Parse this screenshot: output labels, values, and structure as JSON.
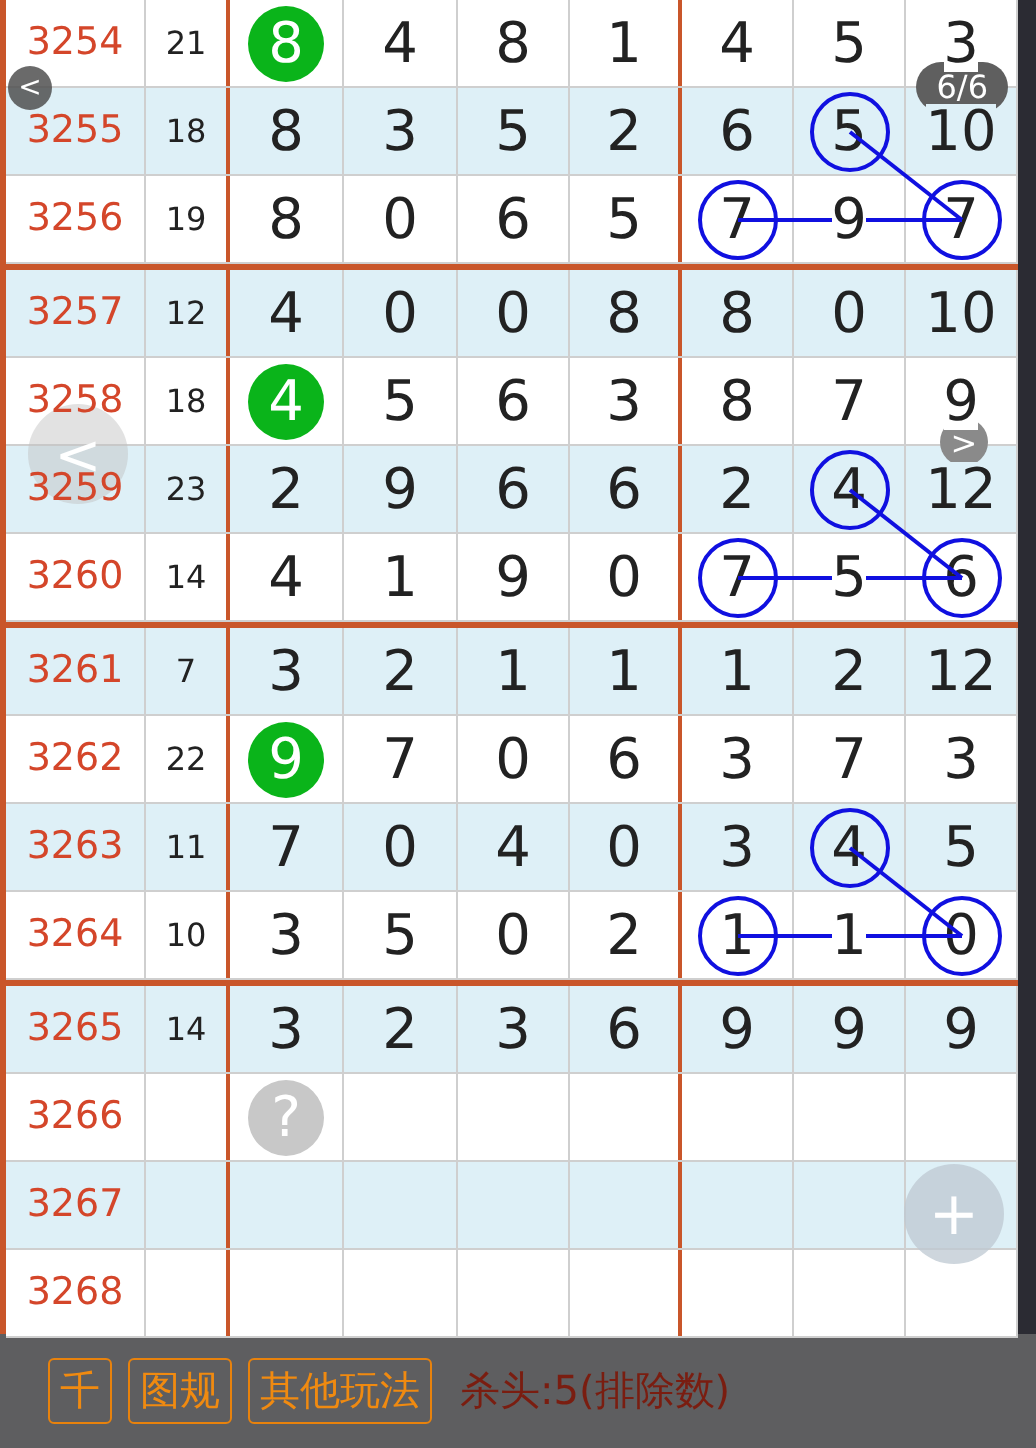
{
  "viewer": {
    "back": "<",
    "counter": "6/6",
    "prev": "<",
    "next": ">",
    "zoom": "+"
  },
  "groups": [
    {
      "rows": [
        {
          "issue": "3254",
          "sum": "21",
          "cells": [
            {
              "text": "8",
              "kind": "ball",
              "color": "#0ab41a"
            },
            {
              "text": "4",
              "kind": "plain"
            },
            {
              "text": "8",
              "kind": "plain"
            },
            {
              "text": "1",
              "kind": "plain"
            },
            {
              "text": "4",
              "kind": "plain"
            },
            {
              "text": "5",
              "kind": "plain"
            },
            {
              "text": "3",
              "kind": "plain"
            }
          ]
        },
        {
          "issue": "3255",
          "sum": "18",
          "cells": [
            {
              "text": "8",
              "kind": "plain"
            },
            {
              "text": "3",
              "kind": "plain"
            },
            {
              "text": "5",
              "kind": "plain"
            },
            {
              "text": "2",
              "kind": "plain"
            },
            {
              "text": "6",
              "kind": "plain"
            },
            {
              "text": "5",
              "kind": "ring"
            },
            {
              "text": "10",
              "kind": "plain"
            }
          ]
        },
        {
          "issue": "3256",
          "sum": "19",
          "cells": [
            {
              "text": "8",
              "kind": "plain"
            },
            {
              "text": "0",
              "kind": "plain"
            },
            {
              "text": "6",
              "kind": "plain"
            },
            {
              "text": "5",
              "kind": "plain"
            },
            {
              "text": "7",
              "kind": "ring"
            },
            {
              "text": "9",
              "kind": "plain"
            },
            {
              "text": "7",
              "kind": "ring"
            }
          ]
        }
      ]
    },
    {
      "rows": [
        {
          "issue": "3257",
          "sum": "12",
          "cells": [
            {
              "text": "4",
              "kind": "plain"
            },
            {
              "text": "0",
              "kind": "plain"
            },
            {
              "text": "0",
              "kind": "plain"
            },
            {
              "text": "8",
              "kind": "plain"
            },
            {
              "text": "8",
              "kind": "plain"
            },
            {
              "text": "0",
              "kind": "plain"
            },
            {
              "text": "10",
              "kind": "plain"
            }
          ]
        },
        {
          "issue": "3258",
          "sum": "18",
          "cells": [
            {
              "text": "4",
              "kind": "ball",
              "color": "#0ab41a"
            },
            {
              "text": "5",
              "kind": "plain"
            },
            {
              "text": "6",
              "kind": "plain"
            },
            {
              "text": "3",
              "kind": "plain"
            },
            {
              "text": "8",
              "kind": "plain"
            },
            {
              "text": "7",
              "kind": "plain"
            },
            {
              "text": "9",
              "kind": "plain"
            }
          ]
        },
        {
          "issue": "3259",
          "sum": "23",
          "cells": [
            {
              "text": "2",
              "kind": "plain"
            },
            {
              "text": "9",
              "kind": "plain"
            },
            {
              "text": "6",
              "kind": "plain"
            },
            {
              "text": "6",
              "kind": "plain"
            },
            {
              "text": "2",
              "kind": "plain"
            },
            {
              "text": "4",
              "kind": "ring"
            },
            {
              "text": "12",
              "kind": "plain"
            }
          ]
        },
        {
          "issue": "3260",
          "sum": "14",
          "cells": [
            {
              "text": "4",
              "kind": "plain"
            },
            {
              "text": "1",
              "kind": "plain"
            },
            {
              "text": "9",
              "kind": "plain"
            },
            {
              "text": "0",
              "kind": "plain"
            },
            {
              "text": "7",
              "kind": "ring"
            },
            {
              "text": "5",
              "kind": "plain"
            },
            {
              "text": "6",
              "kind": "ring"
            }
          ]
        }
      ]
    },
    {
      "rows": [
        {
          "issue": "3261",
          "sum": "7",
          "cells": [
            {
              "text": "3",
              "kind": "plain"
            },
            {
              "text": "2",
              "kind": "plain"
            },
            {
              "text": "1",
              "kind": "plain"
            },
            {
              "text": "1",
              "kind": "plain"
            },
            {
              "text": "1",
              "kind": "plain"
            },
            {
              "text": "2",
              "kind": "plain"
            },
            {
              "text": "12",
              "kind": "plain"
            }
          ]
        },
        {
          "issue": "3262",
          "sum": "22",
          "cells": [
            {
              "text": "9",
              "kind": "ball",
              "color": "#0ab41a"
            },
            {
              "text": "7",
              "kind": "plain"
            },
            {
              "text": "0",
              "kind": "plain"
            },
            {
              "text": "6",
              "kind": "plain"
            },
            {
              "text": "3",
              "kind": "plain"
            },
            {
              "text": "7",
              "kind": "plain"
            },
            {
              "text": "3",
              "kind": "plain"
            }
          ]
        },
        {
          "issue": "3263",
          "sum": "11",
          "cells": [
            {
              "text": "7",
              "kind": "plain"
            },
            {
              "text": "0",
              "kind": "plain"
            },
            {
              "text": "4",
              "kind": "plain"
            },
            {
              "text": "0",
              "kind": "plain"
            },
            {
              "text": "3",
              "kind": "plain"
            },
            {
              "text": "4",
              "kind": "ring"
            },
            {
              "text": "5",
              "kind": "plain"
            }
          ]
        },
        {
          "issue": "3264",
          "sum": "10",
          "cells": [
            {
              "text": "3",
              "kind": "plain"
            },
            {
              "text": "5",
              "kind": "plain"
            },
            {
              "text": "0",
              "kind": "plain"
            },
            {
              "text": "2",
              "kind": "plain"
            },
            {
              "text": "1",
              "kind": "ring"
            },
            {
              "text": "1",
              "kind": "plain"
            },
            {
              "text": "0",
              "kind": "ring"
            }
          ]
        }
      ]
    },
    {
      "rows": [
        {
          "issue": "3265",
          "sum": "14",
          "cells": [
            {
              "text": "3",
              "kind": "plain"
            },
            {
              "text": "2",
              "kind": "plain"
            },
            {
              "text": "3",
              "kind": "plain"
            },
            {
              "text": "6",
              "kind": "plain"
            },
            {
              "text": "9",
              "kind": "plain"
            },
            {
              "text": "9",
              "kind": "plain"
            },
            {
              "text": "9",
              "kind": "plain"
            }
          ]
        },
        {
          "issue": "3266",
          "cells": [
            {
              "text": "?",
              "kind": "unknown"
            }
          ]
        },
        {
          "issue": "3267",
          "cells": []
        },
        {
          "issue": "3268",
          "cells": []
        }
      ]
    }
  ],
  "bottom_bar": {
    "buttons": [
      "千",
      "图规",
      "其他玩法"
    ],
    "note": "杀头:5(排除数)"
  }
}
